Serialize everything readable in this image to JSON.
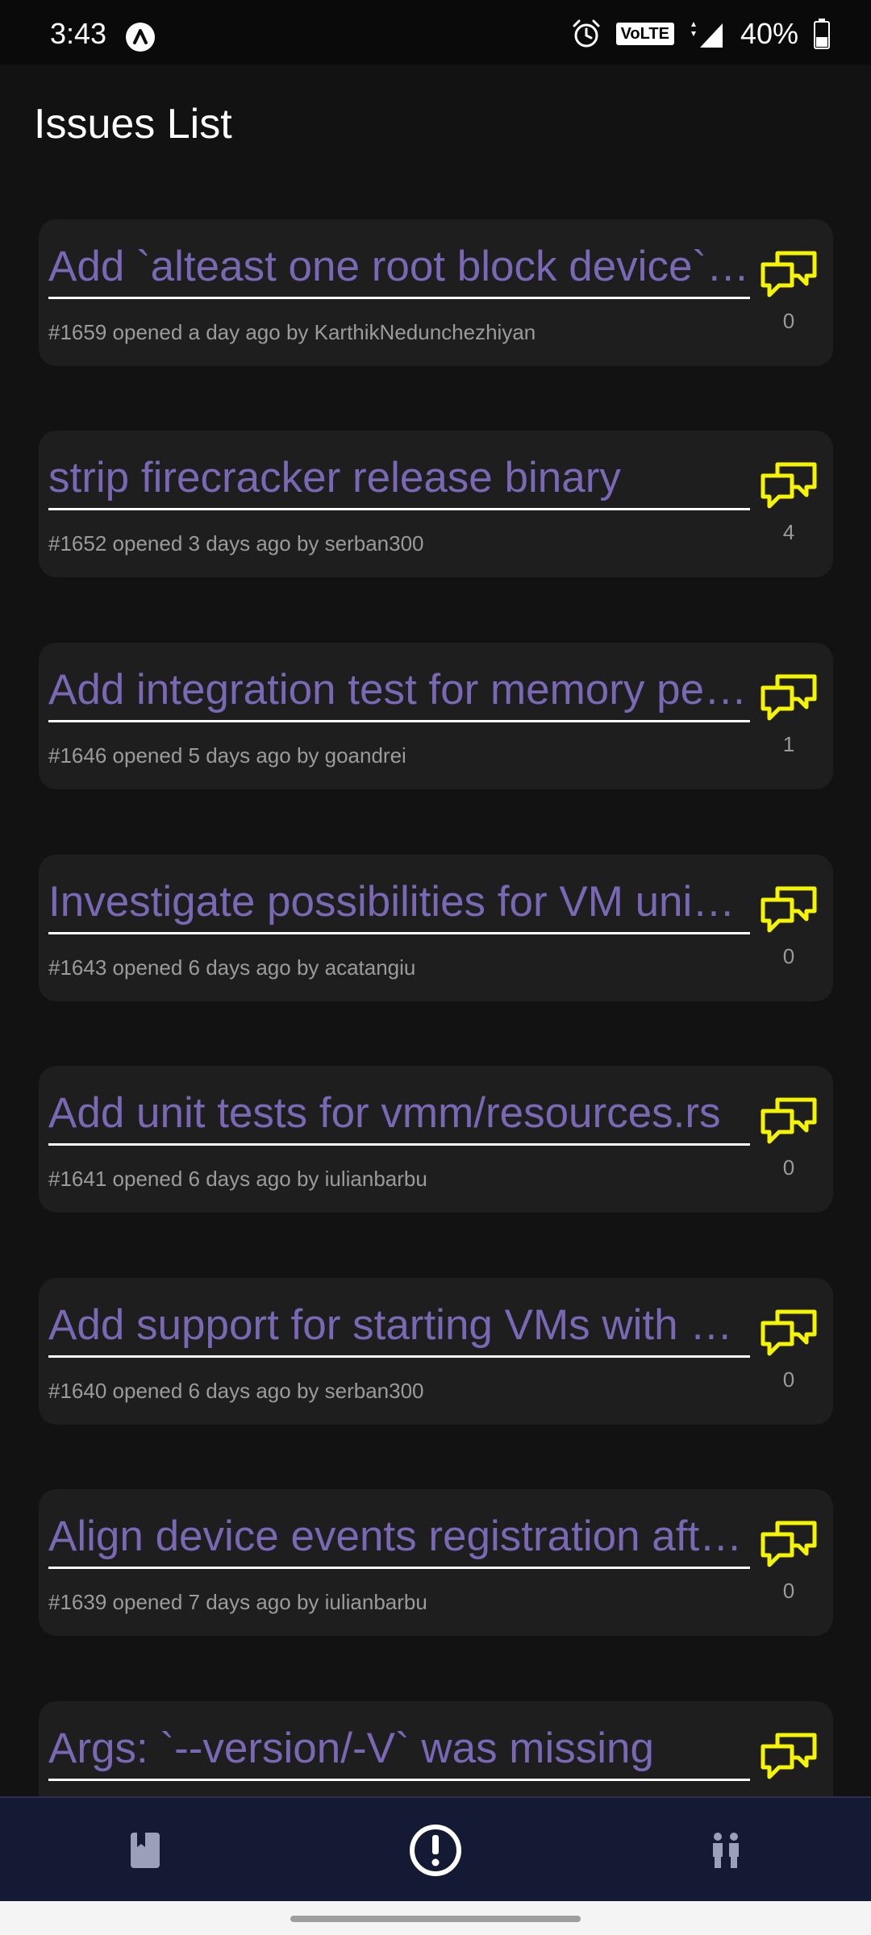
{
  "status_bar": {
    "time": "3:43",
    "network_badge": "VoLTE",
    "network_type": "4G",
    "battery": "40%"
  },
  "app_bar": {
    "title": "Issues List"
  },
  "colors": {
    "title": "#7a68b4",
    "meta": "#9b9b9b",
    "comment_icon": "#f5f500",
    "card": "#1e1e1e",
    "background": "#121212",
    "nav": "#141a33"
  },
  "issues": [
    {
      "title": "Add `alteast one root block device` validation",
      "meta": "#1659 opened a day ago by KarthikNedunchezhiyan",
      "comments": "0"
    },
    {
      "title": "strip firecracker release binary",
      "meta": "#1652 opened 3 days ago by serban300",
      "comments": "4"
    },
    {
      "title": "Add integration test for memory performance",
      "meta": "#1646 opened 5 days ago by goandrei",
      "comments": "1"
    },
    {
      "title": "Investigate possibilities for VM uniqueness",
      "meta": "#1643 opened 6 days ago by acatangiu",
      "comments": "0"
    },
    {
      "title": "Add unit tests for vmm/resources.rs",
      "meta": "#1641 opened 6 days ago by iulianbarbu",
      "comments": "0"
    },
    {
      "title": "Add support for starting VMs with snapshots",
      "meta": "#1640 opened 6 days ago by serban300",
      "comments": "0"
    },
    {
      "title": "Align device events registration after restore",
      "meta": "#1639 opened 7 days ago by iulianbarbu",
      "comments": "0"
    },
    {
      "title": "Args: `--version/-V` was missing",
      "meta": "",
      "comments": ""
    }
  ],
  "bottom_nav": {
    "items": [
      {
        "icon": "book-icon",
        "active": false
      },
      {
        "icon": "issues-alert-icon",
        "active": true
      },
      {
        "icon": "people-icon",
        "active": false
      }
    ]
  }
}
